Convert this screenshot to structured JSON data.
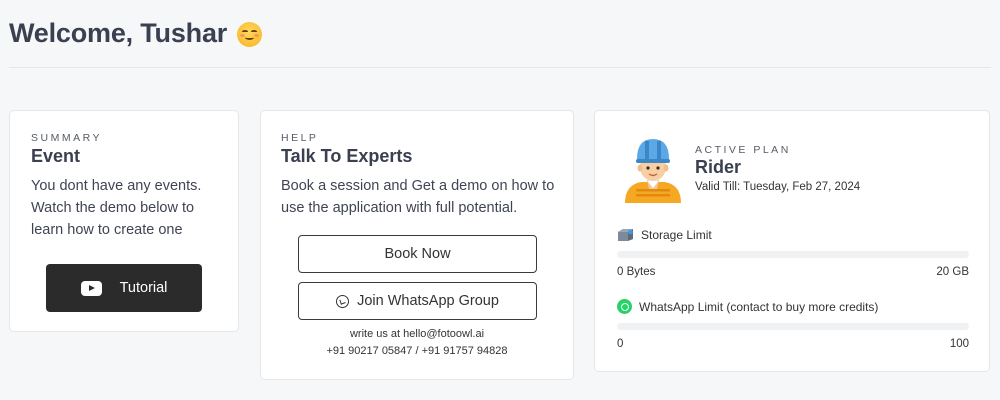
{
  "header": {
    "welcome": "Welcome, Tushar",
    "emoji": "smiling-face-icon"
  },
  "summary": {
    "eyebrow": "SUMMARY",
    "title": "Event",
    "text": "You dont have any events. Watch the demo below to learn how to create one",
    "tutorial_label": "Tutorial",
    "tutorial_icon": "youtube-icon"
  },
  "help": {
    "eyebrow": "HELP",
    "title": "Talk To Experts",
    "text": "Book a session and Get a demo on how to use the application with full potential.",
    "book_label": "Book Now",
    "whatsapp_label": "Join WhatsApp Group",
    "email_line": "write us at hello@fotoowl.ai",
    "phone_line": "+91 90217 05847 / +91 91757 94828"
  },
  "plan": {
    "eyebrow": "ACTIVE PLAN",
    "name": "Rider",
    "valid_till": "Valid Till: Tuesday, Feb 27, 2024",
    "avatar_icon": "rider-avatar-icon",
    "storage": {
      "label": "Storage Limit",
      "min": "0 Bytes",
      "max": "20 GB",
      "used_fraction": 0
    },
    "whatsapp": {
      "label": "WhatsApp Limit (contact to buy more credits)",
      "min": "0",
      "max": "100",
      "used_fraction": 0
    }
  },
  "colors": {
    "background": "#f6f7f9",
    "dark_button": "#2b2b2b",
    "whatsapp_green": "#25d366",
    "title_text": "#3b4050"
  }
}
